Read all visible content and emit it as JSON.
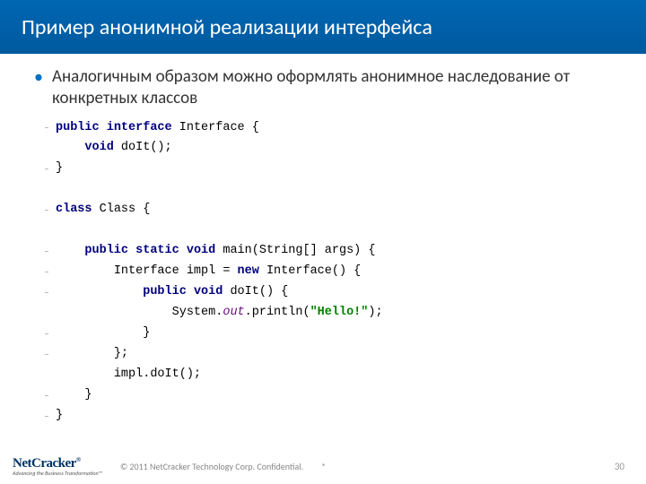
{
  "header": {
    "title": "Пример анонимной реализации интерфейса"
  },
  "bullet": {
    "symbol": "•",
    "text": "Аналогичным образом можно оформлять анонимное наследование от конкретных классов"
  },
  "code": {
    "l1_kw1": "public",
    "l1_kw2": "interface",
    "l1_name": "Interface",
    "l1_brace": " {",
    "l2_kw": "void",
    "l2_rest": " doIt();",
    "l3": "}",
    "l4_kw": "class",
    "l4_name": " Class",
    "l4_brace": " {",
    "l5_kw1": "public",
    "l5_kw2": "static",
    "l5_kw3": "void",
    "l5_rest": " main(String[] args) {",
    "l6a": "Interface impl = ",
    "l6_kw": "new",
    "l6b": " Interface() {",
    "l7_kw1": "public",
    "l7_kw2": "void",
    "l7_rest": " doIt() {",
    "l8a": "System.",
    "l8_field": "out",
    "l8b": ".println(",
    "l8_str": "\"Hello!\"",
    "l8c": ");",
    "l9": "}",
    "l10": "};",
    "l11": "impl.doIt();",
    "l12": "}",
    "l13": "}"
  },
  "footer": {
    "logo_net": "Net",
    "logo_cracker": "Cracker",
    "logo_sup": "®",
    "logo_tag": "Advancing the Business Transformation™",
    "copyright": "© 2011 NetCracker Technology Corp. Confidential.",
    "star": "*",
    "page": "30"
  }
}
